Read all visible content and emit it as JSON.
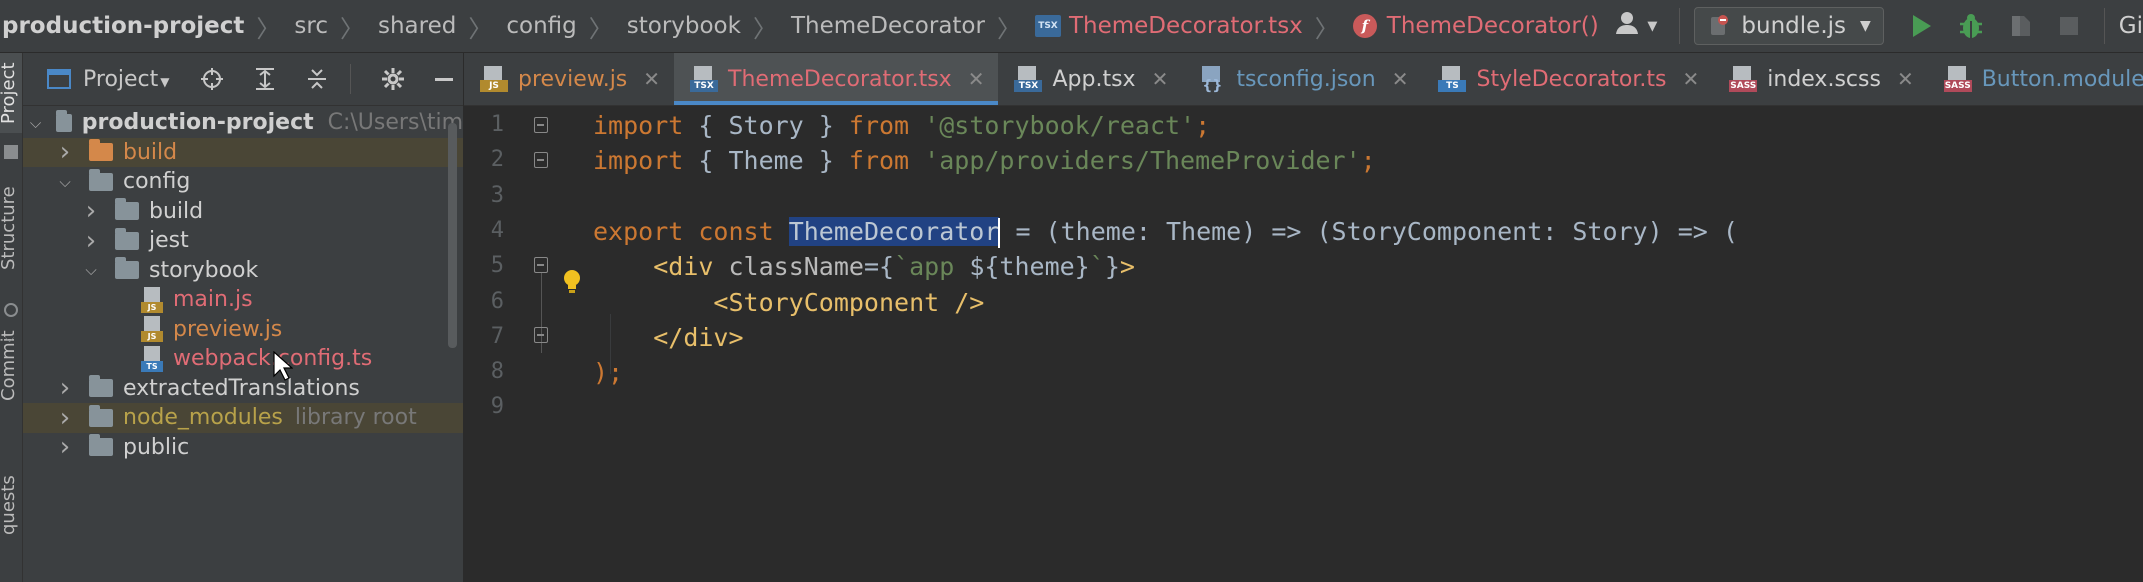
{
  "breadcrumbs": [
    {
      "label": "production-project",
      "style": "bold"
    },
    {
      "label": "src",
      "style": "normal"
    },
    {
      "label": "shared",
      "style": "normal"
    },
    {
      "label": "config",
      "style": "normal"
    },
    {
      "label": "storybook",
      "style": "normal"
    },
    {
      "label": "ThemeDecorator",
      "style": "normal"
    },
    {
      "label": "ThemeDecorator.tsx",
      "style": "red",
      "icon": "tsx-file-icon"
    },
    {
      "label": "ThemeDecorator()",
      "style": "red",
      "icon": "function-icon"
    }
  ],
  "toolbar": {
    "run_config": "bundle.js",
    "git_label": "Gi"
  },
  "left_strip": {
    "project_label": "Project",
    "structure_label": "Structure",
    "commit_label": "Commit",
    "pull_requests_label": "quests"
  },
  "project_panel": {
    "title": "Project",
    "tree": [
      {
        "label": "production-project",
        "type": "folder",
        "depth": 0,
        "open": true,
        "color": "bold",
        "path": "C:\\Users\\tim"
      },
      {
        "label": "build",
        "type": "folder",
        "depth": 1,
        "open": false,
        "color": "orange",
        "excluded": true
      },
      {
        "label": "config",
        "type": "folder",
        "depth": 1,
        "open": true,
        "color": "white"
      },
      {
        "label": "build",
        "type": "folder",
        "depth": 2,
        "open": false,
        "color": "white"
      },
      {
        "label": "jest",
        "type": "folder",
        "depth": 2,
        "open": false,
        "color": "white"
      },
      {
        "label": "storybook",
        "type": "folder",
        "depth": 2,
        "open": true,
        "color": "white"
      },
      {
        "label": "main.js",
        "type": "js",
        "depth": 3,
        "color": "red"
      },
      {
        "label": "preview.js",
        "type": "js",
        "depth": 3,
        "color": "orange"
      },
      {
        "label": "webpack.config.ts",
        "type": "ts",
        "depth": 3,
        "color": "red"
      },
      {
        "label": "extractedTranslations",
        "type": "folder",
        "depth": 1,
        "open": false,
        "color": "white"
      },
      {
        "label": "node_modules",
        "type": "folder",
        "depth": 1,
        "open": false,
        "color": "yellow",
        "excluded": true,
        "lib": "library root"
      },
      {
        "label": "public",
        "type": "folder",
        "depth": 1,
        "open": false,
        "color": "white"
      }
    ]
  },
  "tabs": [
    {
      "label": "preview.js",
      "icon": "js",
      "color": "orange",
      "active": false
    },
    {
      "label": "ThemeDecorator.tsx",
      "icon": "tsx",
      "color": "red",
      "active": true
    },
    {
      "label": "App.tsx",
      "icon": "tsx",
      "color": "white",
      "active": false
    },
    {
      "label": "tsconfig.json",
      "icon": "json",
      "color": "blue",
      "active": false
    },
    {
      "label": "StyleDecorator.ts",
      "icon": "ts",
      "color": "red",
      "active": false
    },
    {
      "label": "index.scss",
      "icon": "sass",
      "color": "white",
      "active": false
    },
    {
      "label": "Button.module.scss",
      "icon": "sass",
      "color": "blue",
      "active": false
    }
  ],
  "editor": {
    "line_numbers": [
      "1",
      "2",
      "3",
      "4",
      "5",
      "6",
      "7",
      "8",
      "9"
    ],
    "lines": [
      [
        {
          "t": "import",
          "c": "kw"
        },
        {
          "t": " { Story } ",
          "c": "p"
        },
        {
          "t": "from",
          "c": "kw"
        },
        {
          "t": " ",
          "c": "p"
        },
        {
          "t": "'@storybook/react'",
          "c": "str"
        },
        {
          "t": ";",
          "c": "kw"
        }
      ],
      [
        {
          "t": "import",
          "c": "kw"
        },
        {
          "t": " { Theme } ",
          "c": "p"
        },
        {
          "t": "from",
          "c": "kw"
        },
        {
          "t": " ",
          "c": "p"
        },
        {
          "t": "'app/providers/ThemeProvider'",
          "c": "str"
        },
        {
          "t": ";",
          "c": "kw"
        }
      ],
      [],
      [
        {
          "t": "export const",
          "c": "kw"
        },
        {
          "t": " ",
          "c": "p"
        },
        {
          "t": "ThemeDecorator",
          "c": "sel"
        },
        {
          "t": "",
          "c": "caret"
        },
        {
          "t": " = (theme: Theme) => (StoryComponent: Story) => (",
          "c": "p"
        }
      ],
      [
        {
          "t": "    ",
          "c": "p"
        },
        {
          "t": "<div ",
          "c": "tagc"
        },
        {
          "t": "className",
          "c": "attrc"
        },
        {
          "t": "={",
          "c": "p"
        },
        {
          "t": "`app ",
          "c": "tpl"
        },
        {
          "t": "${theme}",
          "c": "p"
        },
        {
          "t": "`",
          "c": "tpl"
        },
        {
          "t": "}",
          "c": "p"
        },
        {
          "t": ">",
          "c": "tagc"
        }
      ],
      [
        {
          "t": "        ",
          "c": "p"
        },
        {
          "t": "<StoryComponent />",
          "c": "tagc"
        }
      ],
      [
        {
          "t": "    ",
          "c": "p"
        },
        {
          "t": "</div>",
          "c": "tagc"
        }
      ],
      [
        {
          "t": ");",
          "c": "kw"
        }
      ],
      []
    ]
  }
}
